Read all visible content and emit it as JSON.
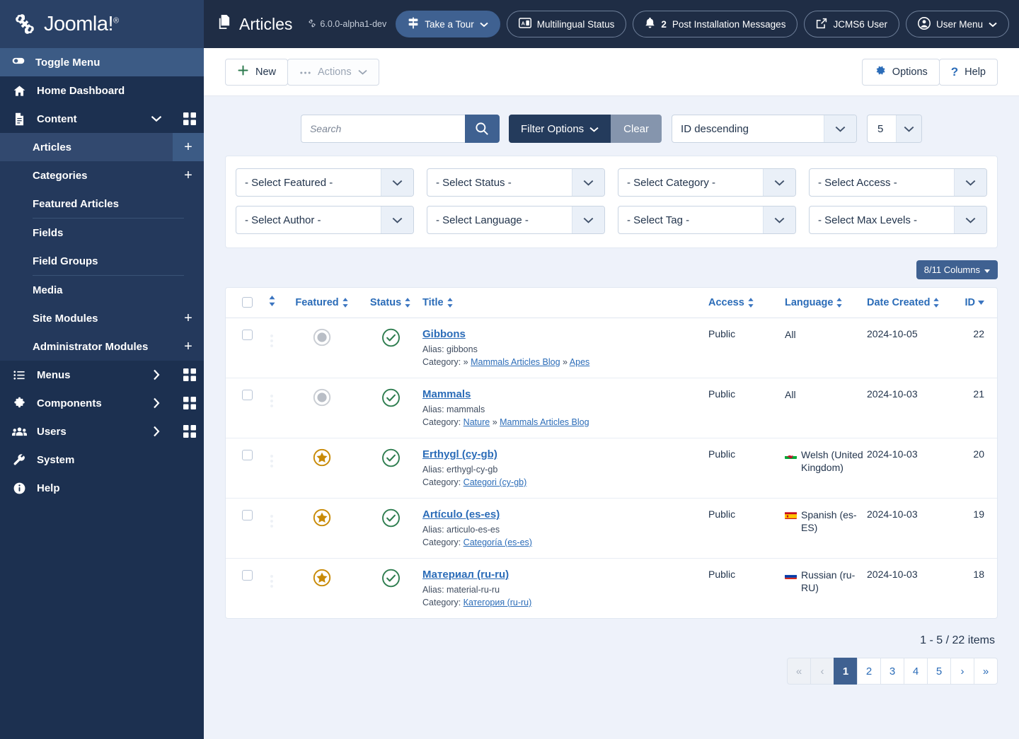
{
  "brand": {
    "name": "Joomla!",
    "reg": "®"
  },
  "sidebar": {
    "toggle_label": "Toggle Menu",
    "items": [
      {
        "label": "Home Dashboard",
        "icon": "home-icon",
        "caret": "",
        "grid": false
      },
      {
        "label": "Content",
        "icon": "document-icon",
        "caret": "⌄",
        "grid": true
      }
    ],
    "content_sub": [
      {
        "label": "Articles",
        "plus": "+",
        "active": true,
        "divider_after": false
      },
      {
        "label": "Categories",
        "plus": "+",
        "active": false,
        "divider_after": false
      },
      {
        "label": "Featured Articles",
        "plus": "",
        "active": false,
        "divider_after": true
      },
      {
        "label": "Fields",
        "plus": "",
        "active": false,
        "divider_after": false
      },
      {
        "label": "Field Groups",
        "plus": "",
        "active": false,
        "divider_after": true
      },
      {
        "label": "Media",
        "plus": "",
        "active": false,
        "divider_after": false
      },
      {
        "label": "Site Modules",
        "plus": "+",
        "active": false,
        "divider_after": false
      },
      {
        "label": "Administrator Modules",
        "plus": "+",
        "active": false,
        "divider_after": false
      }
    ],
    "lower_items": [
      {
        "label": "Menus",
        "icon": "list-icon",
        "caret": "›",
        "grid": true
      },
      {
        "label": "Components",
        "icon": "puzzle-icon",
        "caret": "›",
        "grid": true
      },
      {
        "label": "Users",
        "icon": "users-icon",
        "caret": "›",
        "grid": true
      },
      {
        "label": "System",
        "icon": "wrench-icon",
        "caret": "",
        "grid": false
      },
      {
        "label": "Help",
        "icon": "info-icon",
        "caret": "",
        "grid": false
      }
    ]
  },
  "header": {
    "title": "Articles",
    "title_icon": "copy-icon",
    "version": "6.0.0-alpha1-dev",
    "pills": [
      {
        "label": "Take a Tour",
        "icon": "signpost-icon",
        "caret": "⌄",
        "primary": true,
        "badge": ""
      },
      {
        "label": "Multilingual Status",
        "icon": "language-card-icon",
        "caret": "",
        "primary": false,
        "badge": ""
      },
      {
        "label": "Post Installation Messages",
        "icon": "bell-icon",
        "caret": "",
        "primary": false,
        "badge": "2"
      },
      {
        "label": "JCMS6 User",
        "icon": "external-link-icon",
        "caret": "",
        "primary": false,
        "badge": ""
      },
      {
        "label": "User Menu",
        "icon": "user-circle-icon",
        "caret": "⌄",
        "primary": false,
        "badge": ""
      }
    ]
  },
  "toolbar": {
    "new_label": "New",
    "actions_label": "Actions",
    "options_label": "Options",
    "help_label": "Help"
  },
  "search": {
    "placeholder": "Search",
    "value": "",
    "filter_options_label": "Filter Options",
    "clear_label": "Clear",
    "sort_value": "ID descending",
    "limit_value": "5"
  },
  "filters": [
    {
      "label": "- Select Featured -",
      "name": "filter-featured"
    },
    {
      "label": "- Select Status -",
      "name": "filter-status"
    },
    {
      "label": "- Select Category -",
      "name": "filter-category"
    },
    {
      "label": "- Select Access -",
      "name": "filter-access"
    },
    {
      "label": "- Select Author -",
      "name": "filter-author"
    },
    {
      "label": "- Select Language -",
      "name": "filter-language"
    },
    {
      "label": "- Select Tag -",
      "name": "filter-tag"
    },
    {
      "label": "- Select Max Levels -",
      "name": "filter-max-levels"
    }
  ],
  "columns_button": "8/11 Columns",
  "table": {
    "headers": {
      "featured": "Featured",
      "status": "Status",
      "title": "Title",
      "access": "Access",
      "language": "Language",
      "date_created": "Date Created",
      "id": "ID"
    },
    "rows": [
      {
        "featured": false,
        "status": "published",
        "title": "Gibbons",
        "alias_label": "Alias:",
        "alias": "gibbons",
        "category_label": "Category:",
        "category_prefix": "»",
        "category_links": [
          "Mammals Articles Blog",
          "Apes"
        ],
        "access": "Public",
        "language": "All",
        "language_flag": "",
        "date_created": "2024-10-05",
        "id": "22"
      },
      {
        "featured": false,
        "status": "published",
        "title": "Mammals",
        "alias_label": "Alias:",
        "alias": "mammals",
        "category_label": "Category:",
        "category_prefix": "",
        "category_links": [
          "Nature",
          "Mammals Articles Blog"
        ],
        "access": "Public",
        "language": "All",
        "language_flag": "",
        "date_created": "2024-10-03",
        "id": "21"
      },
      {
        "featured": true,
        "status": "published",
        "title": "Erthygl (cy-gb)",
        "alias_label": "Alias:",
        "alias": "erthygl-cy-gb",
        "category_label": "Category:",
        "category_prefix": "",
        "category_links": [
          "Categori (cy-gb)"
        ],
        "access": "Public",
        "language": "Welsh (United Kingdom)",
        "language_flag": "wales",
        "date_created": "2024-10-03",
        "id": "20"
      },
      {
        "featured": true,
        "status": "published",
        "title": "Artículo (es-es)",
        "alias_label": "Alias:",
        "alias": "articulo-es-es",
        "category_label": "Category:",
        "category_prefix": "",
        "category_links": [
          "Categoría (es-es)"
        ],
        "access": "Public",
        "language": "Spanish (es-ES)",
        "language_flag": "spain",
        "date_created": "2024-10-03",
        "id": "19"
      },
      {
        "featured": true,
        "status": "published",
        "title": "Материал (ru-ru)",
        "alias_label": "Alias:",
        "alias": "material-ru-ru",
        "category_label": "Category:",
        "category_prefix": "",
        "category_links": [
          "Категория (ru-ru)"
        ],
        "access": "Public",
        "language": "Russian (ru-RU)",
        "language_flag": "russia",
        "date_created": "2024-10-03",
        "id": "18"
      }
    ]
  },
  "pagination": {
    "count_text": "1 - 5 / 22 items",
    "buttons": [
      {
        "label": "«",
        "state": "muted"
      },
      {
        "label": "‹",
        "state": "muted"
      },
      {
        "label": "1",
        "state": "active"
      },
      {
        "label": "2",
        "state": "normal"
      },
      {
        "label": "3",
        "state": "normal"
      },
      {
        "label": "4",
        "state": "normal"
      },
      {
        "label": "5",
        "state": "normal"
      },
      {
        "label": "›",
        "state": "normal"
      },
      {
        "label": "»",
        "state": "normal"
      }
    ]
  },
  "colors": {
    "sidebar_bg": "#1c3050",
    "topbar_bg": "#1f2d45",
    "accent_blue": "#3f6191",
    "link_blue": "#2b6cb8",
    "page_bg": "#eef2fa",
    "featured_gold": "#c88a06",
    "published_green": "#2e7d4f"
  }
}
